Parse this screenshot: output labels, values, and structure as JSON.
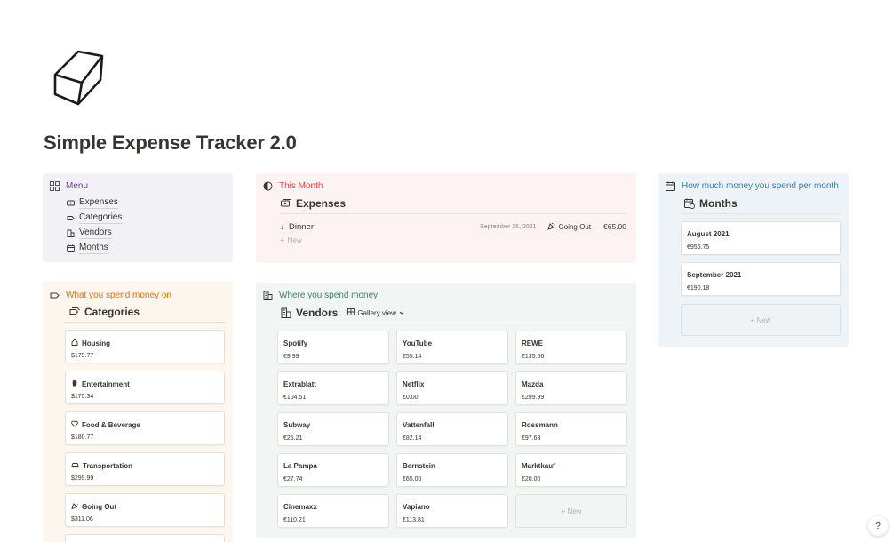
{
  "page": {
    "title": "Simple Expense Tracker 2.0"
  },
  "menu": {
    "title": "Menu",
    "color": "#6940a5",
    "items": [
      {
        "label": "Expenses",
        "icon": "banknote-icon"
      },
      {
        "label": "Categories",
        "icon": "tag-icon"
      },
      {
        "label": "Vendors",
        "icon": "building-icon"
      },
      {
        "label": "Months",
        "icon": "calendar-icon"
      }
    ]
  },
  "this_month": {
    "title": "This Month",
    "color": "#d44c47",
    "db_title": "Expenses",
    "rows": [
      {
        "name": "Dinner",
        "date": "September 26, 2021",
        "category": "Going Out",
        "amount": "€65.00"
      }
    ],
    "new_label": "New"
  },
  "monthly": {
    "title": "How much money you spend per month",
    "color": "#337ea9",
    "db_title": "Months",
    "cards": [
      {
        "name": "August 2021",
        "value": "€956.75"
      },
      {
        "name": "September 2021",
        "value": "€190.18"
      }
    ],
    "new_label": "New"
  },
  "categories": {
    "title": "What you spend money on",
    "color": "#d9730d",
    "db_title": "Categories",
    "cards": [
      {
        "name": "Housing",
        "value": "$179.77",
        "icon": "house-icon"
      },
      {
        "name": "Entertainment",
        "value": "$175.34",
        "icon": "popcorn-icon"
      },
      {
        "name": "Food & Beverage",
        "value": "$180.77",
        "icon": "heart-icon"
      },
      {
        "name": "Transportation",
        "value": "$299.99",
        "icon": "car-icon"
      },
      {
        "name": "Going Out",
        "value": "$311.06",
        "icon": "party-icon"
      }
    ]
  },
  "vendors": {
    "title": "Where you spend money",
    "color": "#448361",
    "db_title": "Vendors",
    "view_label": "Gallery view",
    "cards": [
      {
        "name": "Spotify",
        "value": "€9.99"
      },
      {
        "name": "YouTube",
        "value": "€55.14"
      },
      {
        "name": "REWE",
        "value": "€135.56"
      },
      {
        "name": "Extrablatt",
        "value": "€104.51"
      },
      {
        "name": "Netflix",
        "value": "€0.00"
      },
      {
        "name": "Mazda",
        "value": "€299.99"
      },
      {
        "name": "Subway",
        "value": "€25.21"
      },
      {
        "name": "Vattenfall",
        "value": "€82.14"
      },
      {
        "name": "Rossmann",
        "value": "€97.63"
      },
      {
        "name": "La Pampa",
        "value": "€27.74"
      },
      {
        "name": "Bernstein",
        "value": "€65.00"
      },
      {
        "name": "Marktkauf",
        "value": "€20.00"
      },
      {
        "name": "Cinemaxx",
        "value": "€110.21"
      },
      {
        "name": "Vapiano",
        "value": "€113.81"
      }
    ],
    "new_label": "New"
  },
  "help": {
    "label": "?"
  }
}
